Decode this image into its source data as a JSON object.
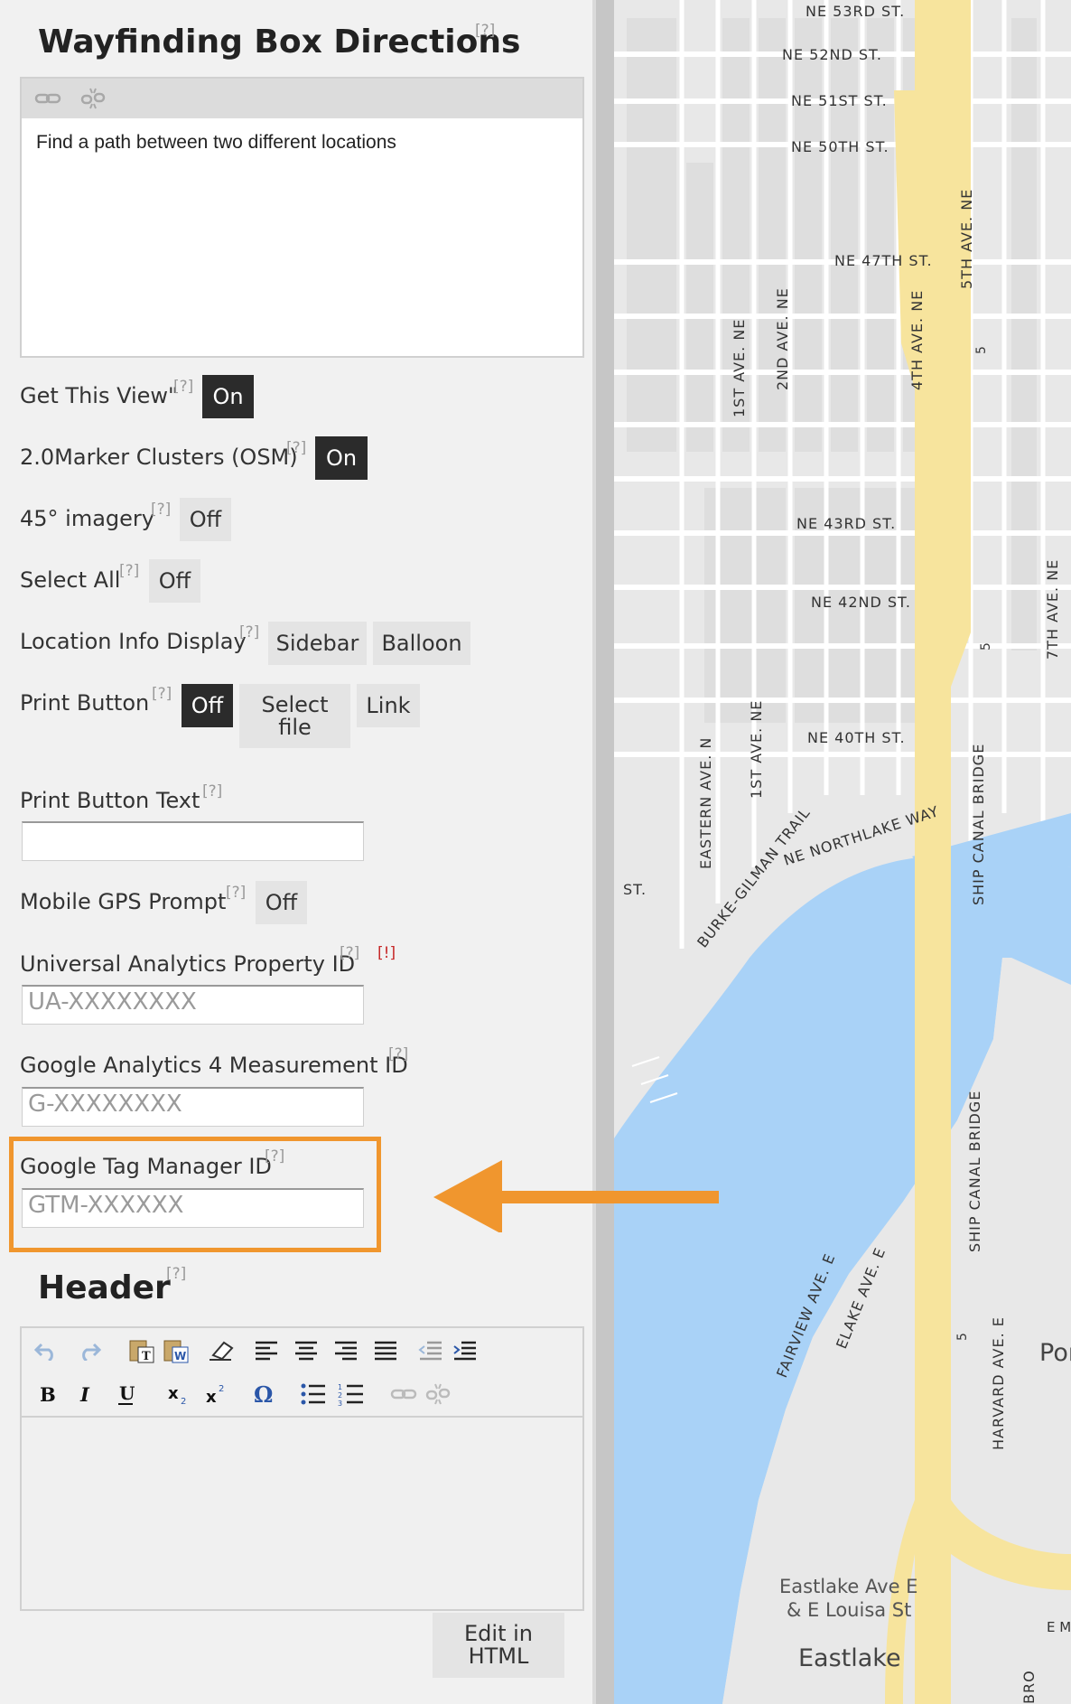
{
  "panel": {
    "title": "Wayfinding Box Directions",
    "help": "[?]",
    "warning": "[!]",
    "description_editor": {
      "text": "Find a path between two different locations"
    },
    "get_this_view": {
      "label": "Get This View\"",
      "value": "On"
    },
    "marker_clusters": {
      "label": "2.0Marker Clusters (OSM)",
      "value": "On"
    },
    "imagery_45": {
      "label": "45° imagery",
      "value": "Off"
    },
    "select_all": {
      "label": "Select All",
      "value": "Off"
    },
    "location_info": {
      "label": "Location Info Display",
      "options": [
        "Sidebar",
        "Balloon"
      ]
    },
    "print_button": {
      "label": "Print Button",
      "options": [
        "Off",
        "Select file",
        "Link"
      ],
      "selected": "Off"
    },
    "print_button_text": {
      "label": "Print Button Text",
      "value": ""
    },
    "mobile_gps": {
      "label": "Mobile GPS Prompt",
      "value": "Off"
    },
    "ua_property": {
      "label": "Universal Analytics Property ID",
      "placeholder": "UA-XXXXXXXX"
    },
    "ga4": {
      "label": "Google Analytics 4 Measurement ID",
      "placeholder": "G-XXXXXXXX"
    },
    "gtm": {
      "label": "Google Tag Manager ID",
      "placeholder": "GTM-XXXXXX"
    },
    "header": {
      "title": "Header",
      "edit_html": "Edit in HTML"
    }
  },
  "map": {
    "streets": [
      "NE 53RD ST.",
      "NE 52ND ST.",
      "NE 51ST ST.",
      "NE 50TH ST.",
      "NE 47TH ST.",
      "NE 43RD ST.",
      "NE 42ND ST.",
      "NE 40TH ST.",
      "NE NORTHLAKE WAY",
      "BURKE-GILMAN TRAIL",
      "ST."
    ],
    "avenues": [
      "5TH AVE. NE",
      "2ND AVE. NE",
      "1ST AVE. NE",
      "4TH AVE. NE",
      "7TH AVE. NE",
      "EASTERN AVE. N",
      "1ST AVE. NE",
      "SHIP CANAL BRIDGE",
      "SHIP CANAL BRIDGE",
      "FAIRVIEW AVE. E",
      "ELAKE AVE. E",
      "HARVARD AVE. E",
      "BRO"
    ],
    "shields": [
      "5",
      "5",
      "5"
    ],
    "places": [
      "Eastlake Ave E",
      "& E Louisa St",
      "Eastlake",
      "Por",
      "E M"
    ],
    "colors": {
      "water": "#a9d2f7",
      "freeway": "#f7e49d",
      "land": "#e8e8e8",
      "road": "#ffffff"
    }
  },
  "accent_color": "#f0962e"
}
